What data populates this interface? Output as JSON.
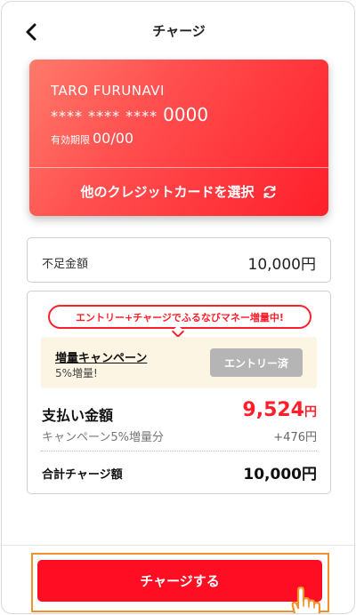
{
  "header": {
    "title": "チャージ"
  },
  "card": {
    "holder_name": "TARO FURUNAVI",
    "number_mask": "**** **** ****",
    "number_last4": "0000",
    "expiry_label": "有効期限",
    "expiry_value": "00/00",
    "select_other_label": "他のクレジットカードを選択"
  },
  "shortage": {
    "label": "不足金額",
    "value": "10,000円"
  },
  "summary": {
    "promo_bubble": "エントリー+チャージでふるなびマネー増量中!",
    "campaign": {
      "title": "増量キャンペーン",
      "subtitle": "5%増量!",
      "entry_status_label": "エントリー済"
    },
    "payment": {
      "label": "支払い金額",
      "amount": "9,524",
      "unit": "円"
    },
    "bonus": {
      "label": "キャンペーン5%増量分",
      "value": "+476円"
    },
    "total": {
      "label": "合計チャージ額",
      "value": "10,000円"
    }
  },
  "footer": {
    "charge_button_label": "チャージする"
  },
  "colors": {
    "accent": "#ff0d22",
    "campaign_bg": "#fcf5e4",
    "highlight_outline": "#f0922b",
    "entry_disabled": "#b5b5b5"
  },
  "icons": {
    "back": "chevron-left-icon",
    "refresh": "refresh-icon",
    "pointer": "hand-pointer-icon"
  }
}
